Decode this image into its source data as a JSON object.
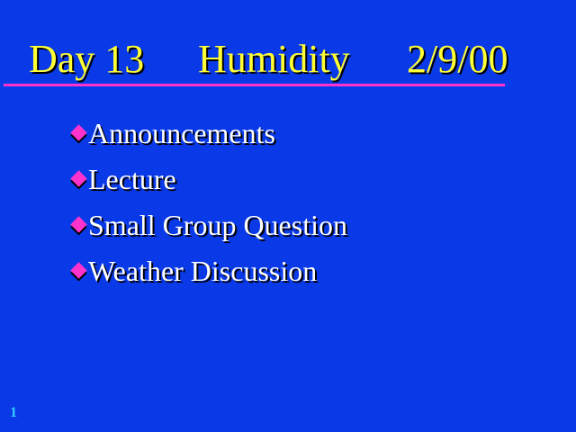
{
  "title": {
    "day": "Day 13",
    "topic": "Humidity",
    "date": "2/9/00"
  },
  "bullets": [
    "Announcements",
    "Lecture",
    "Small Group Question",
    "Weather Discussion"
  ],
  "slide_number": "1",
  "colors": {
    "background": "#0a3ae8",
    "title_text": "#ffff33",
    "accent_rule": "#ff33cc",
    "bullet_marker": "#ff33cc",
    "body_text": "#ffffff",
    "slide_number": "#33ccff"
  },
  "icons": {
    "bullet_marker": "diamond-bullet-icon"
  }
}
